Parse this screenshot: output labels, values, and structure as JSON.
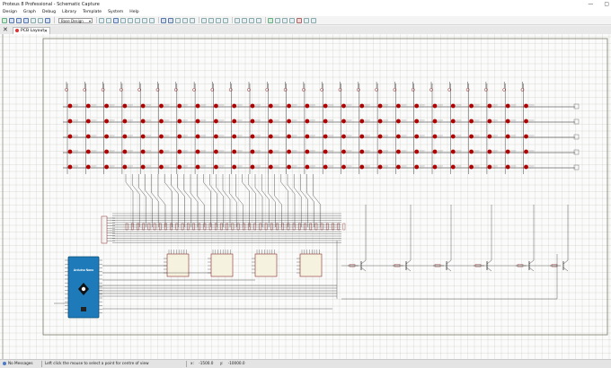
{
  "window": {
    "title": "Proteus 8 Professional - Schematic Capture",
    "minimize": "—",
    "maximize": "▢"
  },
  "menu": [
    "Design",
    "Graph",
    "Debug",
    "Library",
    "Template",
    "System",
    "Help"
  ],
  "toolbar": {
    "design_combo": "Base Design"
  },
  "tabs": [
    {
      "label": "PCB Layout",
      "close": "✕"
    }
  ],
  "tab_close_all": "✕",
  "schematic": {
    "led_rows": 5,
    "led_cols": 26,
    "shift_register_count": 4,
    "transistor_count": 6,
    "arduino_label": "Arduino Nano"
  },
  "status": {
    "messages": "No Messages",
    "hint": "Left click the mouse to select a point for centre of view",
    "x_label": "x:",
    "x_value": "-1500.0",
    "y_label": "y:",
    "y_value": "-10000.0"
  },
  "colors": {
    "led": "#b00000",
    "wire": "#1a1a1a",
    "component_outline": "#8b2a2a",
    "grid": "#c8cab8",
    "arduino": "#1e7ab8"
  }
}
